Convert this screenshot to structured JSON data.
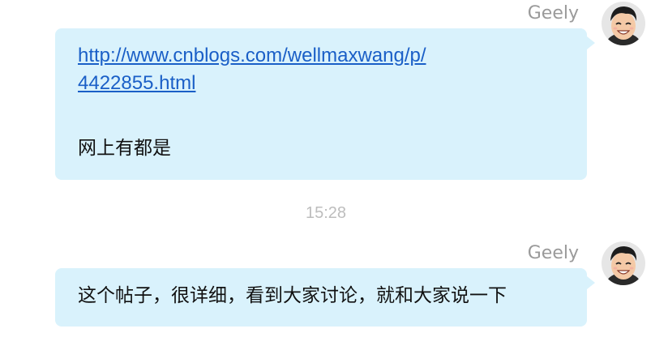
{
  "colors": {
    "bubble_background": "#d9f2fc",
    "link": "#1a5fc7",
    "sender_name": "#9a9a9a",
    "timestamp": "#bdbdbd"
  },
  "messages": [
    {
      "sender": "Geely",
      "link_line1": "http://www.cnblogs.com/wellmaxwang/p/",
      "link_line2": "4422855.html",
      "text": "网上有都是",
      "avatar_icon": "cartoon-man-avatar-icon"
    },
    {
      "sender": "Geely",
      "text": "这个帖子，很详细，看到大家讨论，就和大家说一下",
      "avatar_icon": "cartoon-man-avatar-icon"
    }
  ],
  "timestamp": "15:28"
}
